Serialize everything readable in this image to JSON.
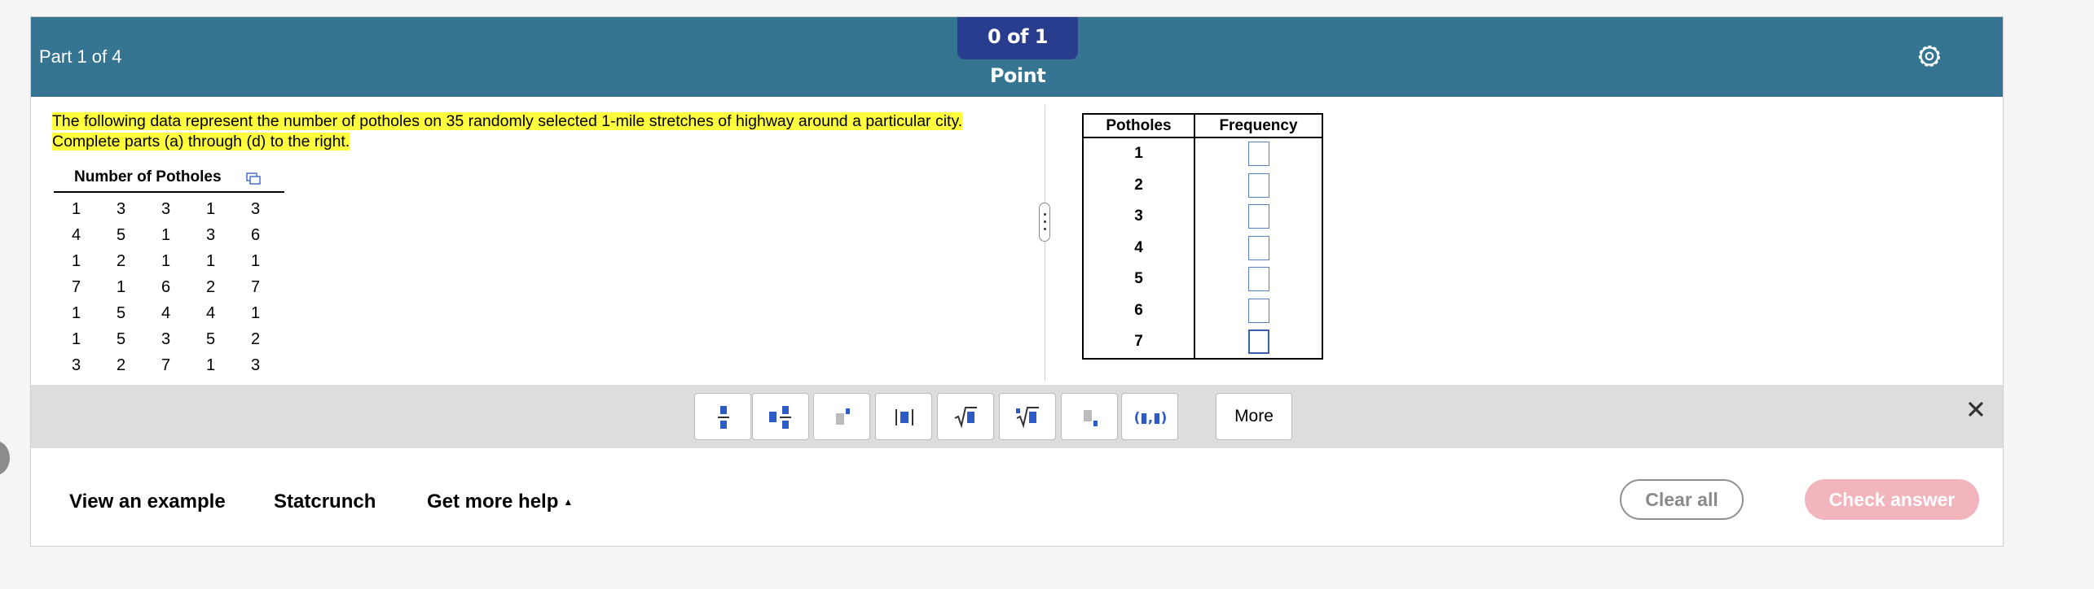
{
  "header": {
    "part_label": "Part 1 of 4",
    "points": "0 of 1 Point",
    "settings_icon": "gear-icon",
    "color": "#367592",
    "badge_color": "#293d8e"
  },
  "problem": {
    "text": "The following data represent the number of potholes on 35 randomly selected 1-mile stretches of highway around a particular city. Complete parts (a) through (d) to the right.",
    "highlight_color": "#ffff3d"
  },
  "data_table": {
    "title": "Number of Potholes",
    "copy_icon": "copy-icon",
    "rows": [
      [
        "1",
        "3",
        "3",
        "1",
        "3"
      ],
      [
        "4",
        "5",
        "1",
        "3",
        "6"
      ],
      [
        "1",
        "2",
        "1",
        "1",
        "1"
      ],
      [
        "7",
        "1",
        "6",
        "2",
        "7"
      ],
      [
        "1",
        "5",
        "4",
        "4",
        "1"
      ],
      [
        "1",
        "5",
        "3",
        "5",
        "2"
      ],
      [
        "3",
        "2",
        "7",
        "1",
        "3"
      ]
    ]
  },
  "frequency_table": {
    "headers": [
      "Potholes",
      "Frequency"
    ],
    "rows": [
      {
        "value": "1",
        "frequency": ""
      },
      {
        "value": "2",
        "frequency": ""
      },
      {
        "value": "3",
        "frequency": ""
      },
      {
        "value": "4",
        "frequency": ""
      },
      {
        "value": "5",
        "frequency": ""
      },
      {
        "value": "6",
        "frequency": ""
      },
      {
        "value": "7",
        "frequency": ""
      }
    ]
  },
  "toolbar": {
    "tools": [
      "fraction-icon",
      "mixed-number-icon",
      "exponent-icon",
      "absolute-value-icon",
      "square-root-icon",
      "nth-root-icon",
      "subscript-icon",
      "ordered-pair-icon"
    ],
    "more_label": "More",
    "close_icon": "close-icon"
  },
  "footer": {
    "view_example": "View an example",
    "statcrunch": "Statcrunch",
    "get_more_help": "Get more help",
    "clear_all": "Clear all",
    "check_answer": "Check answer",
    "check_color": "#f2b4bd"
  }
}
